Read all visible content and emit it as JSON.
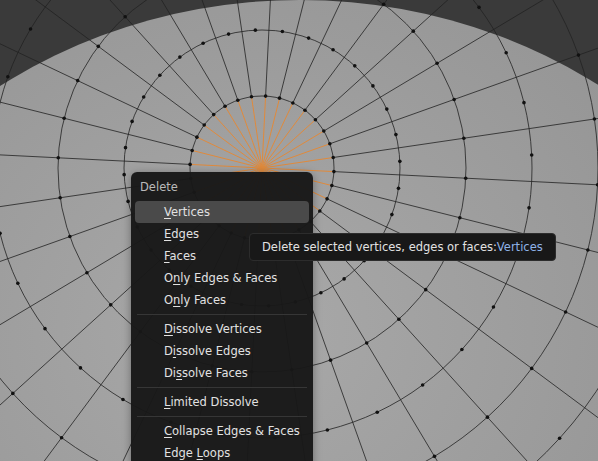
{
  "menu": {
    "title": "Delete",
    "groups": [
      [
        {
          "label": "Vertices",
          "underline": 0,
          "selected": true
        },
        {
          "label": "Edges",
          "underline": 0,
          "selected": false
        },
        {
          "label": "Faces",
          "underline": 0,
          "selected": false
        },
        {
          "label": "Only Edges & Faces",
          "underline": 1,
          "selected": false
        },
        {
          "label": "Only Faces",
          "underline": 1,
          "selected": false
        }
      ],
      [
        {
          "label": "Dissolve Vertices",
          "underline": 0,
          "selected": false
        },
        {
          "label": "Dissolve Edges",
          "underline": 1,
          "selected": false
        },
        {
          "label": "Dissolve Faces",
          "underline": 2,
          "selected": false
        }
      ],
      [
        {
          "label": "Limited Dissolve",
          "underline": 0,
          "selected": false
        }
      ],
      [
        {
          "label": "Collapse Edges & Faces",
          "underline": 0,
          "selected": false
        },
        {
          "label": "Edge Loops",
          "underline": 5,
          "selected": false
        }
      ]
    ]
  },
  "tooltip": {
    "text": "Delete selected vertices, edges or faces: ",
    "value": "Vertices"
  }
}
